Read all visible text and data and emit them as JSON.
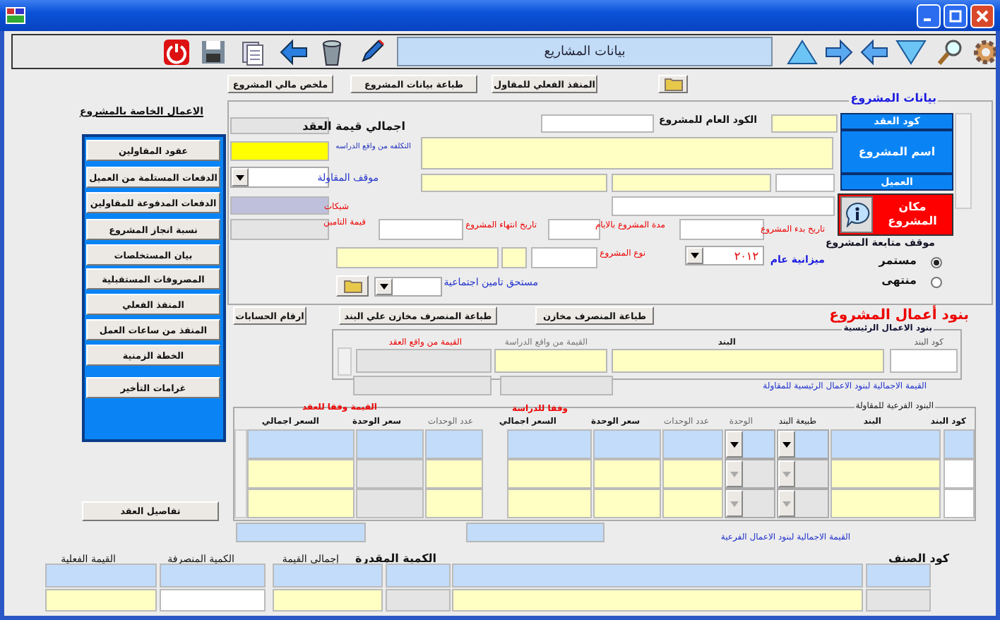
{
  "toolbar": {
    "title": "بيانات المشاريع"
  },
  "top_buttons": [
    "المنفذ الفعلي للمقاول",
    "طباعة بيانات المشروع",
    "ملخص مالي المشروع"
  ],
  "side_panel": {
    "heading": "الاعمال الخاصة بالمشروع",
    "buttons": [
      "عقود المقاولين",
      "الدفعات المستلمة من العميل",
      "الدفعات المدفوعة للمقاولين",
      "نسبة انجاز المشروع",
      "بيان المستخلصات",
      "المصروفات المستقبلية",
      "المنفذ الفعلي",
      "المنفذ من ساعات العمل",
      "الخطة الزمنية",
      "غرامات التأخير"
    ],
    "details_button": "تفاصيل العقد"
  },
  "project": {
    "title": "بيانات المشروع",
    "general_code_label": "الكود العام للمشروع",
    "list_headers": [
      "كود العقد",
      "اسم المشروع",
      "العميل"
    ],
    "location_label": "مكان المشروع",
    "contract_total_label": "اجمالي قيمة العقد",
    "study_cost_label": "التكلفه من واقع الدراسه",
    "contract_status_label": "موقف المقاولة",
    "cheques_label": "شيكات",
    "insurance_value_label": "قيمة التامين",
    "end_date_label": "تاريخ انتهاء المشروع",
    "duration_label": "مدة المشروع بالايام",
    "start_date_label": "تاريخ بدء المشروع",
    "type_label": "نوع المشروع",
    "budget_label": "ميزانية عام",
    "budget_year": "٢٠١٢",
    "social_insurance_label": "مستحق تامين اجتماعية",
    "follow_status": {
      "label": "موقف متابعة المشروع",
      "options": [
        {
          "label": "مستمر",
          "selected": true
        },
        {
          "label": "منتهى",
          "selected": false
        }
      ]
    }
  },
  "items": {
    "title": "بنود أعمال المشروع",
    "buttons": [
      "طباعة المنصرف مخازن",
      "طباعة المنصرف مخازن علي البند",
      "ارقام الحسابات"
    ],
    "main": {
      "title": "بنود الاعمال الرئيسية",
      "columns": [
        "كود البند",
        "البند",
        "القيمة من واقع الدراسة",
        "القيمة من واقع العقد"
      ],
      "total_note": "القيمة الاجمالية لبنود الاعمال الرئيسية للمقاولة"
    },
    "sub": {
      "title": "البنود الفرعية للمقاولة",
      "study_group": "وفقا للدراسة",
      "contract_group": "القيمة وفقا للعقد",
      "columns": [
        "كود البند",
        "البند",
        "طبيعة البند",
        "الوحدة",
        "عدد الوحدات",
        "سعر الوحدة",
        "السعر اجمالي",
        "عدد الوحدات",
        "سعر الوحدة",
        "السعر اجمالي"
      ],
      "total_note": "القيمة الاجمالية لبنود الاعمال الفرعية"
    },
    "bottom": {
      "columns": [
        "كود الصنف",
        "الكمية المقدرة",
        "إجمالي القيمة",
        "الكمية المنصرفة",
        "القيمة الفعلية"
      ]
    }
  }
}
